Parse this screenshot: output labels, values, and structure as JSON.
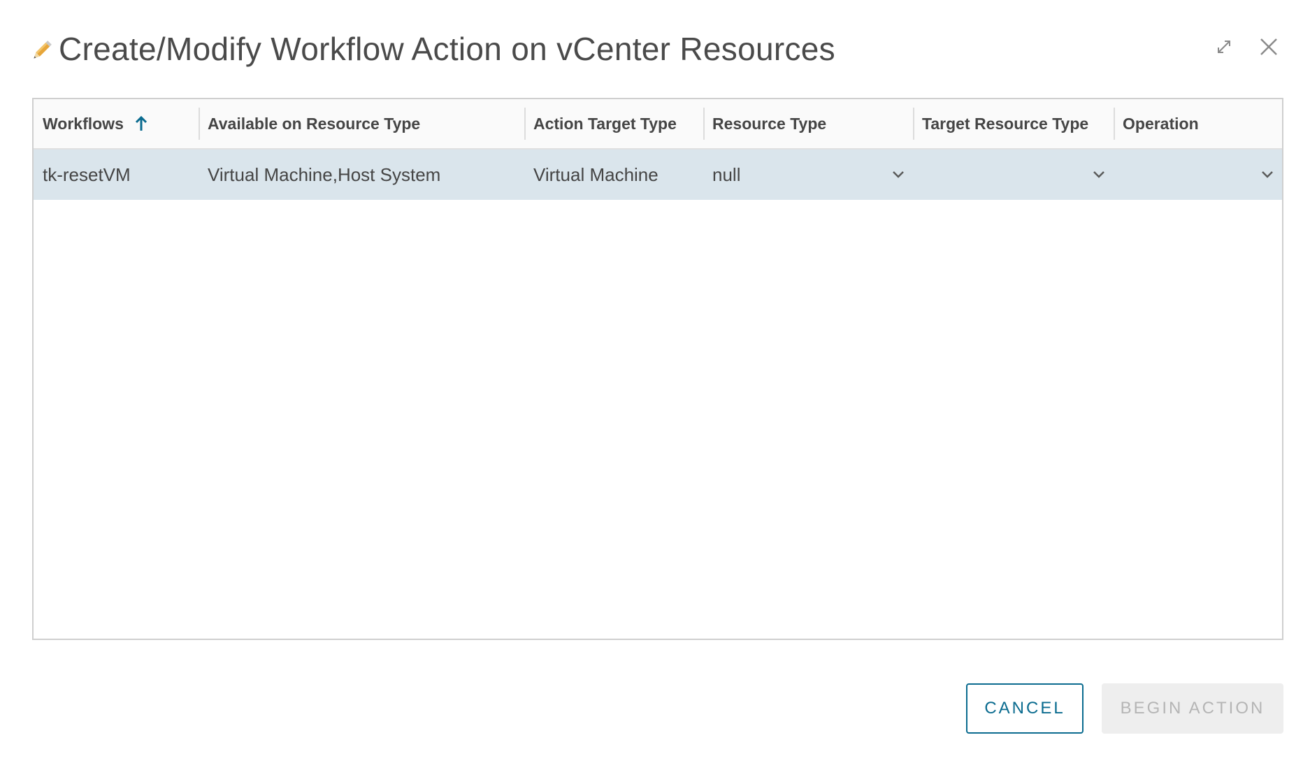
{
  "dialog": {
    "title": "Create/Modify Workflow Action on vCenter Resources",
    "title_icon": "pencil-icon",
    "maximize_icon": "maximize-icon",
    "close_icon": "close-icon"
  },
  "grid": {
    "columns": [
      {
        "label": "Workflows",
        "sort": "ascending"
      },
      {
        "label": "Available on Resource Type"
      },
      {
        "label": "Action Target Type"
      },
      {
        "label": "Resource Type"
      },
      {
        "label": "Target Resource Type"
      },
      {
        "label": "Operation"
      }
    ],
    "rows": [
      {
        "workflow": "tk-resetVM",
        "available_on": "Virtual Machine,Host System",
        "action_target": "Virtual Machine",
        "resource_type": "null",
        "target_resource_type": "",
        "operation": "",
        "selected": true
      }
    ]
  },
  "footer": {
    "cancel_label": "CANCEL",
    "begin_label": "BEGIN ACTION",
    "begin_disabled": true
  },
  "colors": {
    "accent": "#0a6b8f",
    "selected_row": "#dae5ec",
    "disabled_button_bg": "#eeeeee",
    "disabled_button_text": "#b5b5b5",
    "pencil": "#e0a030"
  }
}
